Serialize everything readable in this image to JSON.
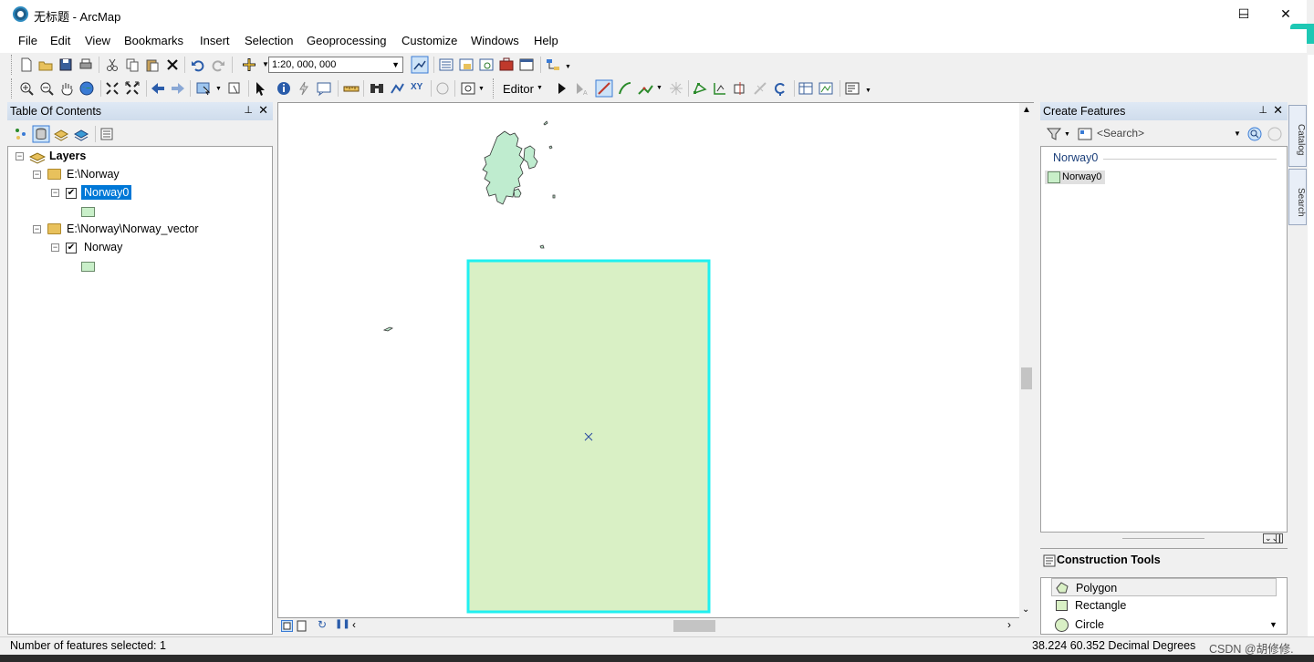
{
  "window": {
    "title": "无标题 - ArcMap",
    "minimize": "─",
    "maximize": "☐",
    "close": "✕"
  },
  "menu": [
    "File",
    "Edit",
    "View",
    "Bookmarks",
    "Insert",
    "Selection",
    "Geoprocessing",
    "Customize",
    "Windows",
    "Help"
  ],
  "toolbar": {
    "scale": "1:20, 000, 000",
    "editor_label": "Editor"
  },
  "toc": {
    "title": "Table Of Contents",
    "root": "Layers",
    "groups": [
      {
        "path": "E:\\Norway",
        "layer": "Norway0",
        "selected": true
      },
      {
        "path": "E:\\Norway\\Norway_vector",
        "layer": "Norway",
        "selected": false
      }
    ]
  },
  "create_features": {
    "title": "Create Features",
    "search_placeholder": "<Search>",
    "group": "Norway0",
    "template": "Norway0",
    "construction_title": "Construction Tools",
    "tools": [
      "Polygon",
      "Rectangle",
      "Circle"
    ]
  },
  "side_tabs": [
    "Catalog",
    "Search"
  ],
  "status": {
    "selection": "Number of features selected: 1",
    "coords": "38.224  60.352 Decimal Degrees",
    "watermark": "CSDN @胡修修."
  },
  "colors": {
    "feature_fill": "#d9f0c5",
    "selection_outline": "#20f0f0",
    "land_fill": "#bfeccf",
    "accent": "#0078d7"
  }
}
